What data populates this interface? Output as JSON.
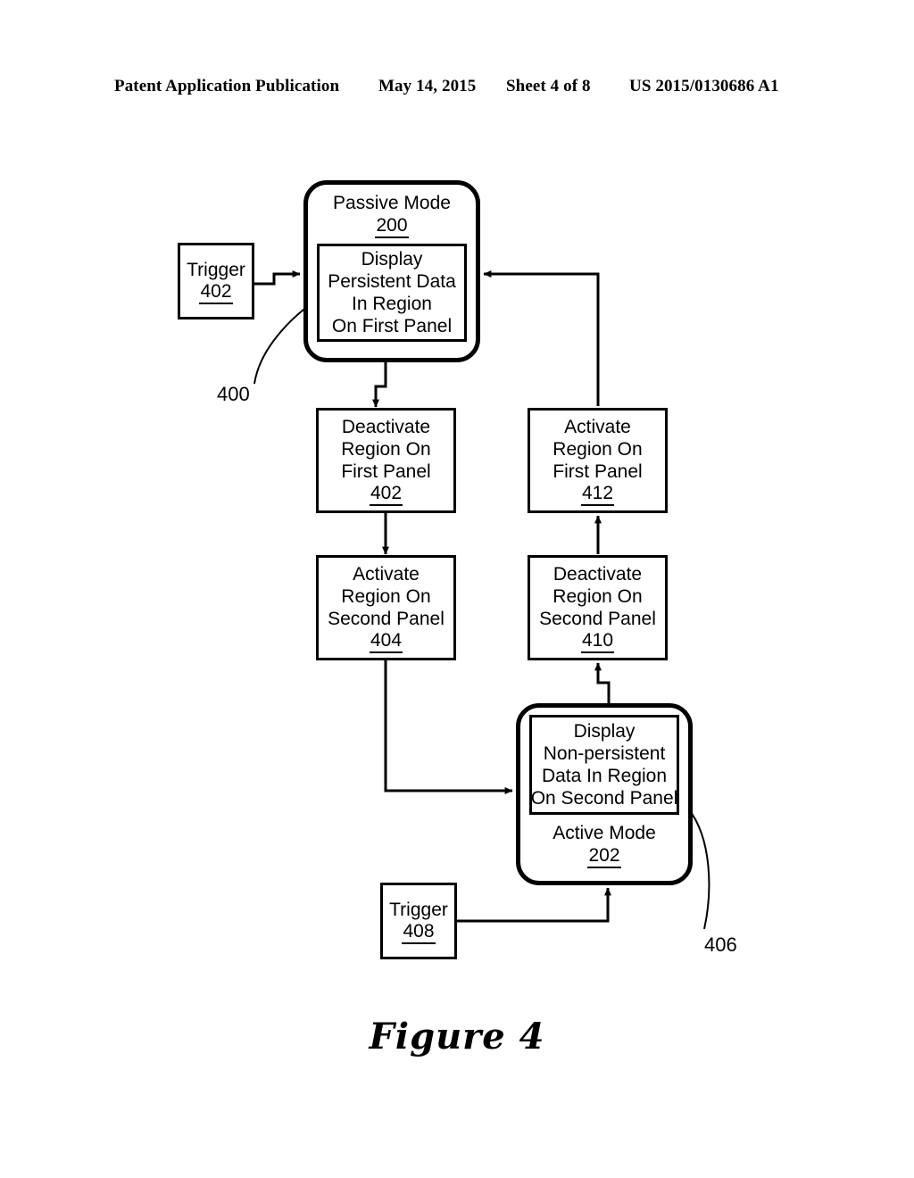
{
  "header": {
    "publication": "Patent Application Publication",
    "date": "May 14, 2015",
    "sheet": "Sheet 4 of 8",
    "patent_number": "US 2015/0130686 A1"
  },
  "caption": "Figure 4",
  "diagram": {
    "title": "Figure 4 flow diagram",
    "passive_mode": {
      "label": "Passive Mode",
      "ref": "200",
      "inner": {
        "line1": "Display",
        "line2": "Persistent Data",
        "line3": "In Region",
        "line4": "On First Panel"
      },
      "leader_ref": "400"
    },
    "active_mode": {
      "label": "Active Mode",
      "ref": "202",
      "inner": {
        "line1": "Display",
        "line2": "Non-persistent",
        "line3": "Data In Region",
        "line4": "On Second Panel"
      },
      "leader_ref": "406"
    },
    "trigger_top": {
      "label": "Trigger",
      "ref": "402"
    },
    "trigger_bottom": {
      "label": "Trigger",
      "ref": "408"
    },
    "deactivate_first": {
      "line1": "Deactivate",
      "line2": "Region On",
      "line3": "First Panel",
      "ref": "402"
    },
    "activate_first": {
      "line1": "Activate",
      "line2": "Region On",
      "line3": "First Panel",
      "ref": "412"
    },
    "activate_second": {
      "line1": "Activate",
      "line2": "Region On",
      "line3": "Second Panel",
      "ref": "404"
    },
    "deactivate_second": {
      "line1": "Deactivate",
      "line2": "Region On",
      "line3": "Second Panel",
      "ref": "410"
    },
    "colors": {
      "ink": "#000000",
      "paper": "#ffffff"
    }
  }
}
